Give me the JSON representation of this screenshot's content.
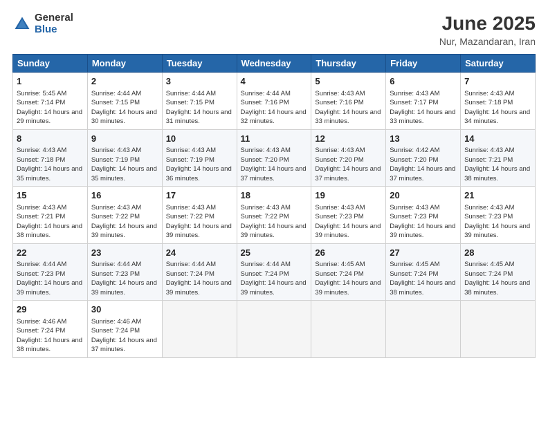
{
  "logo": {
    "general": "General",
    "blue": "Blue"
  },
  "title": "June 2025",
  "subtitle": "Nur, Mazandaran, Iran",
  "days_header": [
    "Sunday",
    "Monday",
    "Tuesday",
    "Wednesday",
    "Thursday",
    "Friday",
    "Saturday"
  ],
  "weeks": [
    [
      {
        "day": 1,
        "sunrise": "5:45 AM",
        "sunset": "7:14 PM",
        "daylight": "14 hours and 29 minutes."
      },
      {
        "day": 2,
        "sunrise": "4:44 AM",
        "sunset": "7:15 PM",
        "daylight": "14 hours and 30 minutes."
      },
      {
        "day": 3,
        "sunrise": "4:44 AM",
        "sunset": "7:15 PM",
        "daylight": "14 hours and 31 minutes."
      },
      {
        "day": 4,
        "sunrise": "4:44 AM",
        "sunset": "7:16 PM",
        "daylight": "14 hours and 32 minutes."
      },
      {
        "day": 5,
        "sunrise": "4:43 AM",
        "sunset": "7:16 PM",
        "daylight": "14 hours and 33 minutes."
      },
      {
        "day": 6,
        "sunrise": "4:43 AM",
        "sunset": "7:17 PM",
        "daylight": "14 hours and 33 minutes."
      },
      {
        "day": 7,
        "sunrise": "4:43 AM",
        "sunset": "7:18 PM",
        "daylight": "14 hours and 34 minutes."
      }
    ],
    [
      {
        "day": 8,
        "sunrise": "4:43 AM",
        "sunset": "7:18 PM",
        "daylight": "14 hours and 35 minutes."
      },
      {
        "day": 9,
        "sunrise": "4:43 AM",
        "sunset": "7:19 PM",
        "daylight": "14 hours and 35 minutes."
      },
      {
        "day": 10,
        "sunrise": "4:43 AM",
        "sunset": "7:19 PM",
        "daylight": "14 hours and 36 minutes."
      },
      {
        "day": 11,
        "sunrise": "4:43 AM",
        "sunset": "7:20 PM",
        "daylight": "14 hours and 37 minutes."
      },
      {
        "day": 12,
        "sunrise": "4:43 AM",
        "sunset": "7:20 PM",
        "daylight": "14 hours and 37 minutes."
      },
      {
        "day": 13,
        "sunrise": "4:42 AM",
        "sunset": "7:20 PM",
        "daylight": "14 hours and 37 minutes."
      },
      {
        "day": 14,
        "sunrise": "4:43 AM",
        "sunset": "7:21 PM",
        "daylight": "14 hours and 38 minutes."
      }
    ],
    [
      {
        "day": 15,
        "sunrise": "4:43 AM",
        "sunset": "7:21 PM",
        "daylight": "14 hours and 38 minutes."
      },
      {
        "day": 16,
        "sunrise": "4:43 AM",
        "sunset": "7:22 PM",
        "daylight": "14 hours and 39 minutes."
      },
      {
        "day": 17,
        "sunrise": "4:43 AM",
        "sunset": "7:22 PM",
        "daylight": "14 hours and 39 minutes."
      },
      {
        "day": 18,
        "sunrise": "4:43 AM",
        "sunset": "7:22 PM",
        "daylight": "14 hours and 39 minutes."
      },
      {
        "day": 19,
        "sunrise": "4:43 AM",
        "sunset": "7:23 PM",
        "daylight": "14 hours and 39 minutes."
      },
      {
        "day": 20,
        "sunrise": "4:43 AM",
        "sunset": "7:23 PM",
        "daylight": "14 hours and 39 minutes."
      },
      {
        "day": 21,
        "sunrise": "4:43 AM",
        "sunset": "7:23 PM",
        "daylight": "14 hours and 39 minutes."
      }
    ],
    [
      {
        "day": 22,
        "sunrise": "4:44 AM",
        "sunset": "7:23 PM",
        "daylight": "14 hours and 39 minutes."
      },
      {
        "day": 23,
        "sunrise": "4:44 AM",
        "sunset": "7:23 PM",
        "daylight": "14 hours and 39 minutes."
      },
      {
        "day": 24,
        "sunrise": "4:44 AM",
        "sunset": "7:24 PM",
        "daylight": "14 hours and 39 minutes."
      },
      {
        "day": 25,
        "sunrise": "4:44 AM",
        "sunset": "7:24 PM",
        "daylight": "14 hours and 39 minutes."
      },
      {
        "day": 26,
        "sunrise": "4:45 AM",
        "sunset": "7:24 PM",
        "daylight": "14 hours and 39 minutes."
      },
      {
        "day": 27,
        "sunrise": "4:45 AM",
        "sunset": "7:24 PM",
        "daylight": "14 hours and 38 minutes."
      },
      {
        "day": 28,
        "sunrise": "4:45 AM",
        "sunset": "7:24 PM",
        "daylight": "14 hours and 38 minutes."
      }
    ],
    [
      {
        "day": 29,
        "sunrise": "4:46 AM",
        "sunset": "7:24 PM",
        "daylight": "14 hours and 38 minutes."
      },
      {
        "day": 30,
        "sunrise": "4:46 AM",
        "sunset": "7:24 PM",
        "daylight": "14 hours and 37 minutes."
      },
      null,
      null,
      null,
      null,
      null
    ]
  ]
}
